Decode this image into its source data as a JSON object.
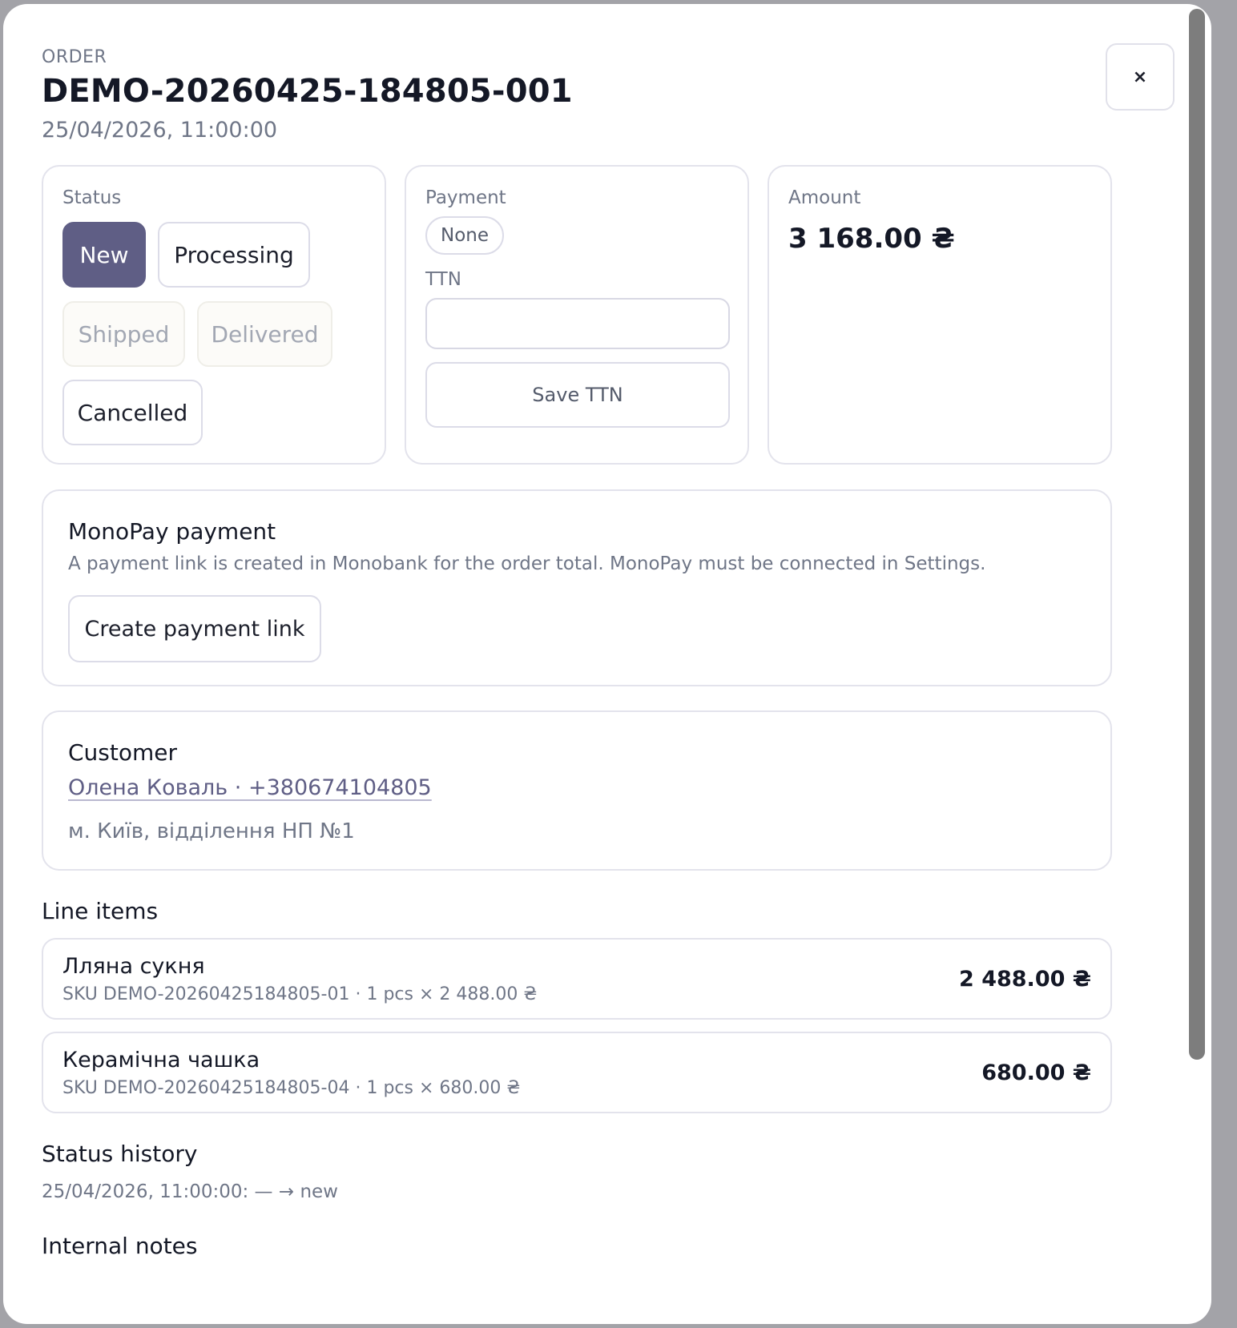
{
  "order": {
    "eyebrow": "ORDER",
    "id": "DEMO-20260425-184805-001",
    "date": "25/04/2026, 11:00:00",
    "close_label": "×"
  },
  "status": {
    "label": "Status",
    "options": [
      {
        "label": "New",
        "state": "active"
      },
      {
        "label": "Processing",
        "state": "enabled"
      },
      {
        "label": "Shipped",
        "state": "disabled"
      },
      {
        "label": "Delivered",
        "state": "disabled"
      },
      {
        "label": "Cancelled",
        "state": "enabled"
      }
    ]
  },
  "payment": {
    "label": "Payment",
    "value": "None",
    "ttn_label": "TTN",
    "ttn_value": "",
    "save_ttn_label": "Save TTN"
  },
  "amount": {
    "label": "Amount",
    "value": "3 168.00 ₴"
  },
  "monopay": {
    "title": "MonoPay payment",
    "description": "A payment link is created in Monobank for the order total. MonoPay must be connected in Settings.",
    "button_label": "Create payment link"
  },
  "customer": {
    "title": "Customer",
    "name_phone": "Олена Коваль · +380674104805",
    "address": "м. Київ, відділення НП №1"
  },
  "line_items": {
    "title": "Line items",
    "items": [
      {
        "name": "Лляна сукня",
        "meta": "SKU DEMO-20260425184805-01 · 1 pcs × 2 488.00 ₴",
        "total": "2 488.00 ₴"
      },
      {
        "name": "Керамічна чашка",
        "meta": "SKU DEMO-20260425184805-04 · 1 pcs × 680.00 ₴",
        "total": "680.00 ₴"
      }
    ]
  },
  "status_history": {
    "title": "Status history",
    "entries": [
      "25/04/2026, 11:00:00: — → new"
    ]
  },
  "internal_notes": {
    "title": "Internal notes"
  },
  "colors": {
    "accent": "#5f5e85",
    "muted_text": "#6f7687",
    "border": "#e3e3ec"
  }
}
